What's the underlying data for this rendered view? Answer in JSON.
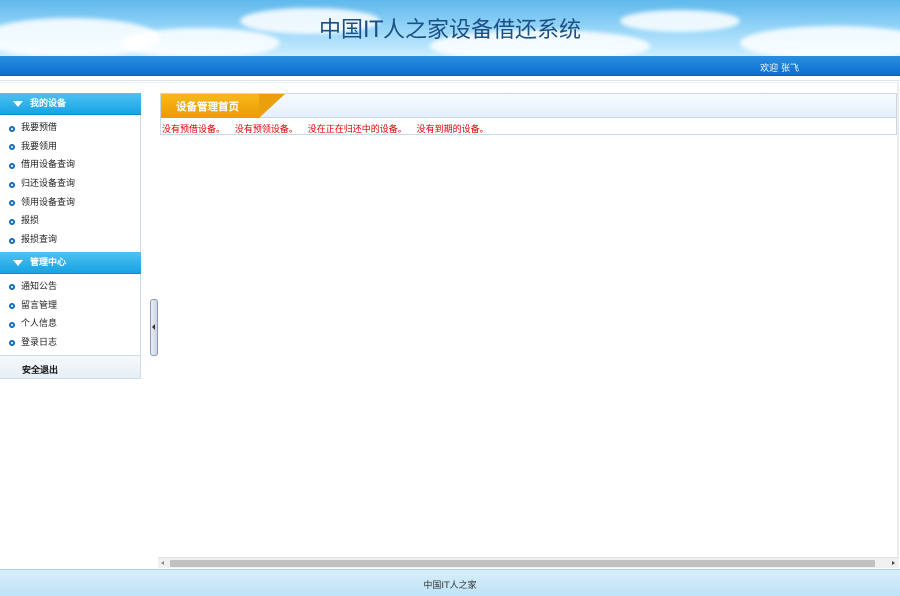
{
  "header": {
    "title": "中国IT人之家设备借还系统",
    "welcome": "欢迎 张飞"
  },
  "sidebar": {
    "sections": [
      {
        "title": "我的设备",
        "items": [
          "我要预借",
          "我要领用",
          "借用设备查询",
          "归还设备查询",
          "领用设备查询",
          "报损",
          "报损查询"
        ]
      },
      {
        "title": "管理中心",
        "items": [
          "通知公告",
          "留言管理",
          "个人信息",
          "登录日志"
        ]
      }
    ],
    "logout": "安全退出"
  },
  "main": {
    "tab": "设备管理首页",
    "notices": [
      "没有预借设备。",
      "没有预领设备。",
      "没在正在归还中的设备。",
      "没有到期的设备。"
    ]
  },
  "footer": {
    "text": "中国IT人之家"
  },
  "colors": {
    "topbar": "#0d6fcf",
    "sidebar_header": "#17a3e4",
    "tab": "#f0a70c",
    "notice_text": "#e00000"
  },
  "icons": {
    "section_toggle": "triangle-down-icon",
    "item_bullet": "circle-bullet-icon",
    "collapse_handle": "chevron-left-icon"
  }
}
